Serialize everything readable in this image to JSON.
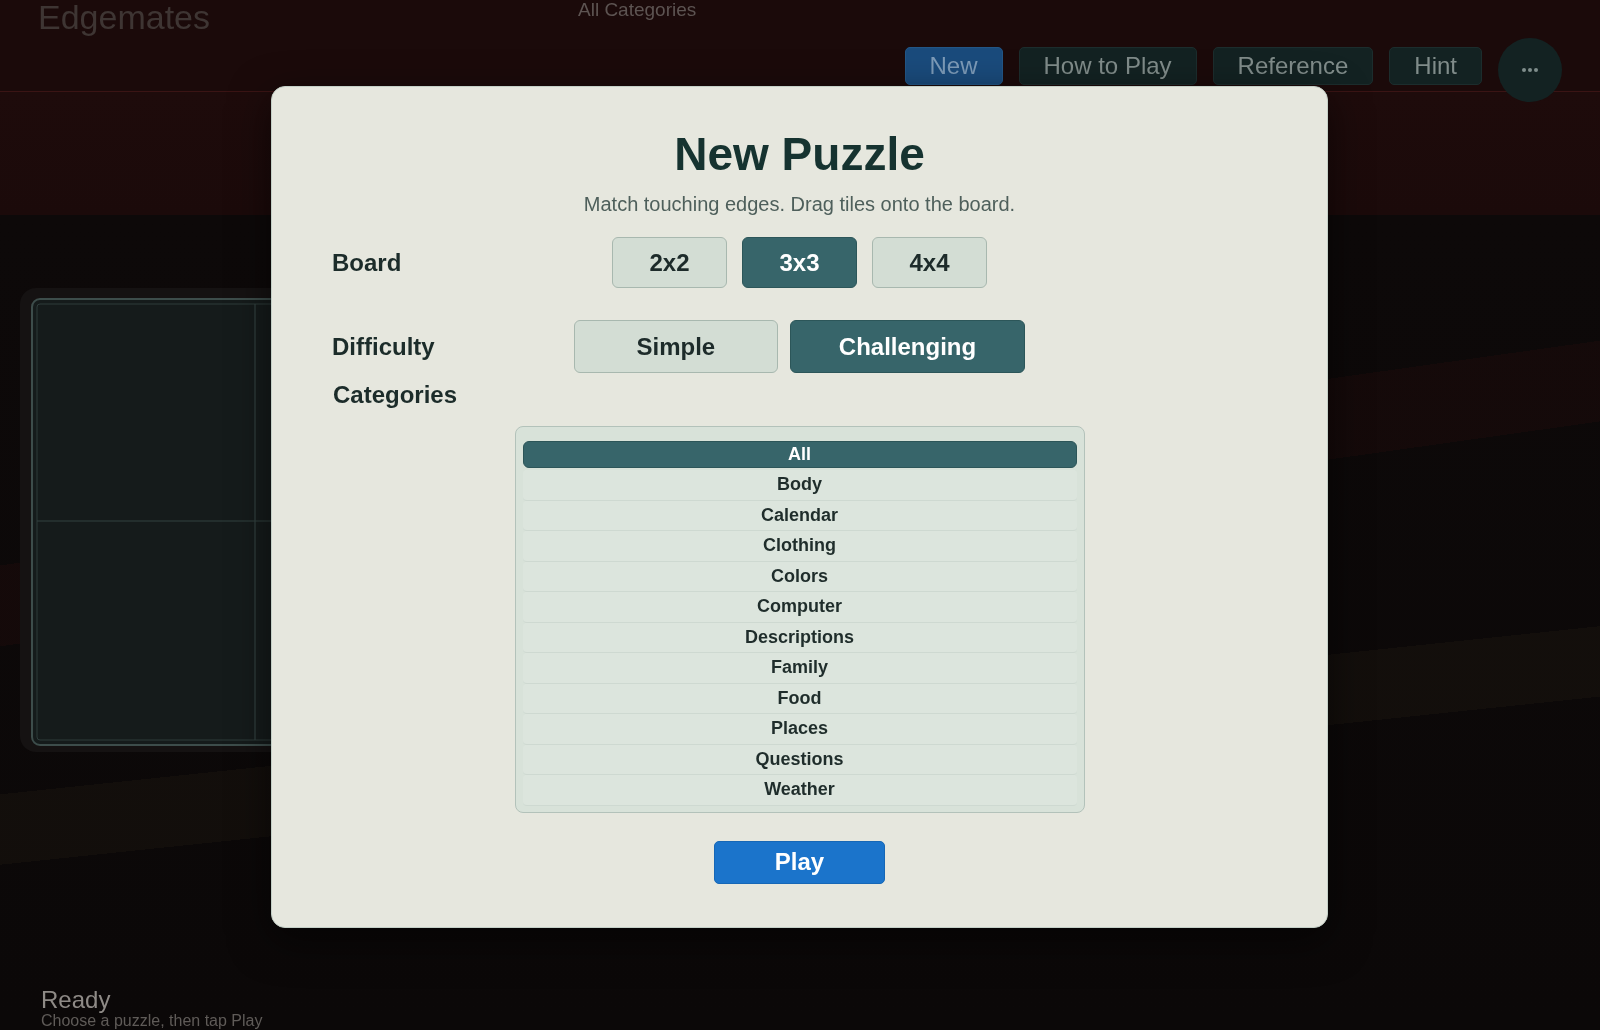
{
  "app": {
    "title": "Edgemates",
    "subtitle": "All Categories"
  },
  "toolbar": {
    "buttons": [
      {
        "label": "New",
        "kind": "primary"
      },
      {
        "label": "How to Play",
        "kind": "secondary"
      },
      {
        "label": "Reference",
        "kind": "secondary"
      },
      {
        "label": "Hint",
        "kind": "secondary"
      }
    ]
  },
  "status": {
    "title": "Ready",
    "message": "Choose a puzzle, then tap Play"
  },
  "dialog": {
    "title": "New Puzzle",
    "subtitle": "Match touching edges. Drag tiles onto the board.",
    "board": {
      "label": "Board",
      "options": [
        {
          "label": "2x2",
          "selected": false
        },
        {
          "label": "3x3",
          "selected": true
        },
        {
          "label": "4x4",
          "selected": false
        }
      ]
    },
    "difficulty": {
      "label": "Difficulty",
      "options": [
        {
          "label": "Simple",
          "selected": false
        },
        {
          "label": "Challenging",
          "selected": true
        }
      ]
    },
    "categories": {
      "label": "Categories",
      "items": [
        {
          "label": "All",
          "selected": true
        },
        {
          "label": "Body",
          "selected": false
        },
        {
          "label": "Calendar",
          "selected": false
        },
        {
          "label": "Clothing",
          "selected": false
        },
        {
          "label": "Colors",
          "selected": false
        },
        {
          "label": "Computer",
          "selected": false
        },
        {
          "label": "Descriptions",
          "selected": false
        },
        {
          "label": "Family",
          "selected": false
        },
        {
          "label": "Food",
          "selected": false
        },
        {
          "label": "Places",
          "selected": false
        },
        {
          "label": "Questions",
          "selected": false
        },
        {
          "label": "Weather",
          "selected": false
        }
      ]
    },
    "play_button": "Play"
  }
}
